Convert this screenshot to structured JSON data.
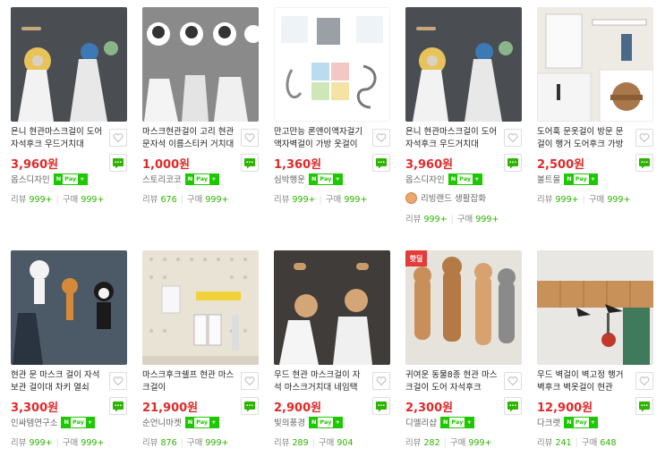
{
  "products": [
    {
      "title": "욘니 현관마스크걸이 도어자석후크 우드거치대",
      "price": "3,960원",
      "seller": "옵스디자인",
      "npay": true,
      "reviews": "999+",
      "purchases": "999+"
    },
    {
      "title": "마스크현관걸이 고리 현관문자석 이름스티커 거치대",
      "price": "1,000원",
      "seller": "스토리코코",
      "npay": true,
      "reviews": "676",
      "purchases": "999+"
    },
    {
      "title": "만고만능 론앤이액자걸기 액자벽걸이 가방 옷걸이",
      "price": "1,360원",
      "seller": "심박행운",
      "npay": true,
      "reviews": "999+",
      "purchases": "999+"
    },
    {
      "title": "욘니 현관마스크걸이 도어자석후크 우드거치대",
      "price": "3,960원",
      "seller": "옵스디자인",
      "npay": true,
      "badge": "리빙랜드 생활잡화",
      "reviews": "999+",
      "purchases": "999+"
    },
    {
      "title": "도어훅 문옷걸이 방문 문걸이 행거 도어후크 가방",
      "price": "2,500원",
      "seller": "볼트몰",
      "npay": true,
      "reviews": "999+",
      "purchases": "999+"
    },
    {
      "title": "현관 문 마스크 걸이 자석 보관 걸이대 차키 열쇠",
      "price": "3,300원",
      "seller": "인싸템연구소",
      "npay": true,
      "reviews": "999+",
      "purchases": "999+"
    },
    {
      "title": "마스크후크쉘프 현관 마스크걸이",
      "price": "21,900원",
      "seller": "순언니마켓",
      "npay": true,
      "reviews": "876",
      "purchases": "999+"
    },
    {
      "title": "우드 현관 마스크걸이 자석 마스크거치대 네임택",
      "price": "2,900원",
      "seller": "빛의풍경",
      "npay": true,
      "reviews": "289",
      "purchases": "904"
    },
    {
      "title": "귀여운 동물8종 현관 마스크걸이 도어 자석후크",
      "price": "2,300원",
      "seller": "디엘리샵",
      "npay": true,
      "reviews": "282",
      "purchases": "999+",
      "hot": "핫딜"
    },
    {
      "title": "우드 벽걸이 벽고정 행거 벽후크 벽옷걸이 현관",
      "price": "12,900원",
      "seller": "다크랫",
      "npay": true,
      "reviews": "241",
      "purchases": "648"
    }
  ],
  "labels": {
    "review": "리뷰",
    "purchase": "구매",
    "npay_p": "Pay",
    "npay_n": "N",
    "npay_plus": "+"
  },
  "colors": {
    "price": "#e02a2a",
    "npay": "#1ec800",
    "count": "#2db400"
  }
}
